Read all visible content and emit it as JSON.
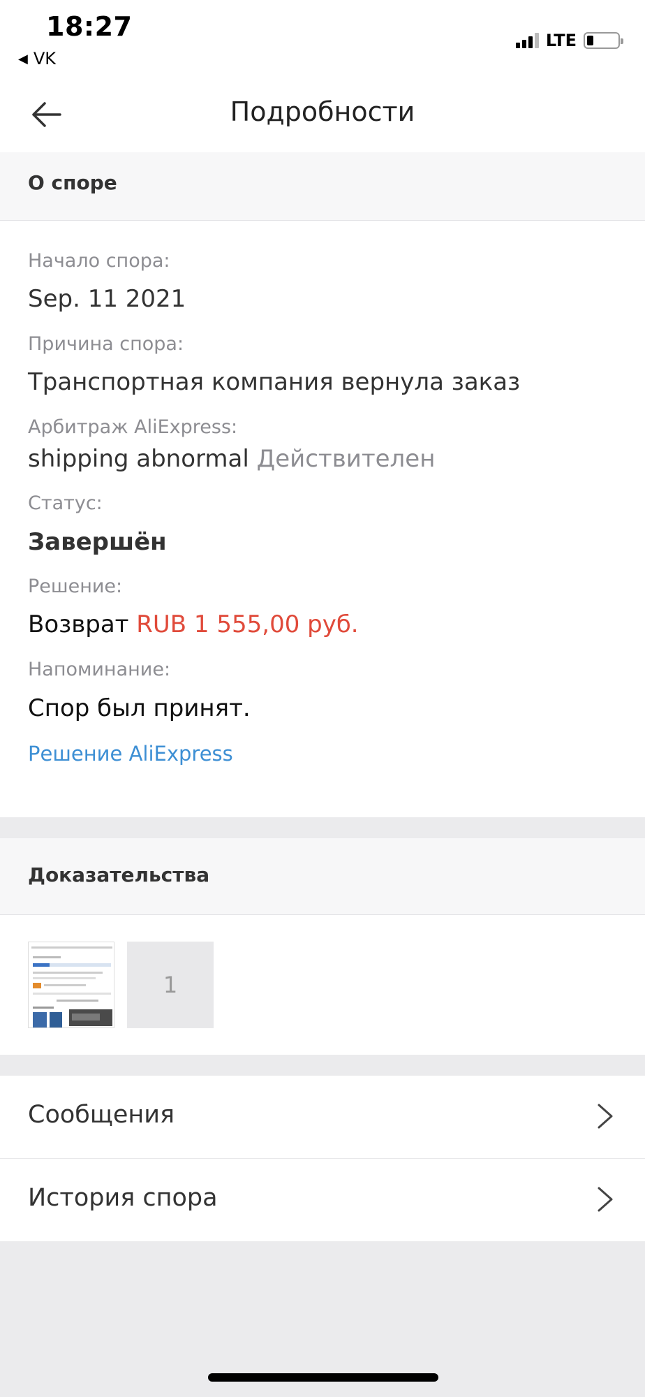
{
  "status_bar": {
    "time": "18:27",
    "back_app": "VK",
    "network": "LTE",
    "signal_bars": 3,
    "battery_level": 0.12
  },
  "nav": {
    "title": "Подробности"
  },
  "dispute": {
    "header": "О споре",
    "start_label": "Начало спора:",
    "start_value": "Sep. 11 2021",
    "reason_label": "Причина спора:",
    "reason_value": "Транспортная компания вернула заказ",
    "arbitration_label": "Арбитраж AliExpress:",
    "arbitration_value": "shipping abnormal",
    "arbitration_status": "Действителен",
    "status_label": "Статус:",
    "status_value": "Завершён",
    "decision_label": "Решение:",
    "decision_prefix": "Возврат",
    "decision_amount": "RUB 1 555,00 руб.",
    "reminder_label": "Напоминание:",
    "reminder_value": "Спор был принят.",
    "aliexpress_decision_link": "Решение AliExpress"
  },
  "evidence": {
    "header": "Доказательства",
    "extra_count": "1"
  },
  "menu": {
    "messages": "Сообщения",
    "history": "История спора"
  },
  "colors": {
    "accent_red": "#e04a3a",
    "link_blue": "#3d8fd4",
    "background": "#ebebed"
  }
}
